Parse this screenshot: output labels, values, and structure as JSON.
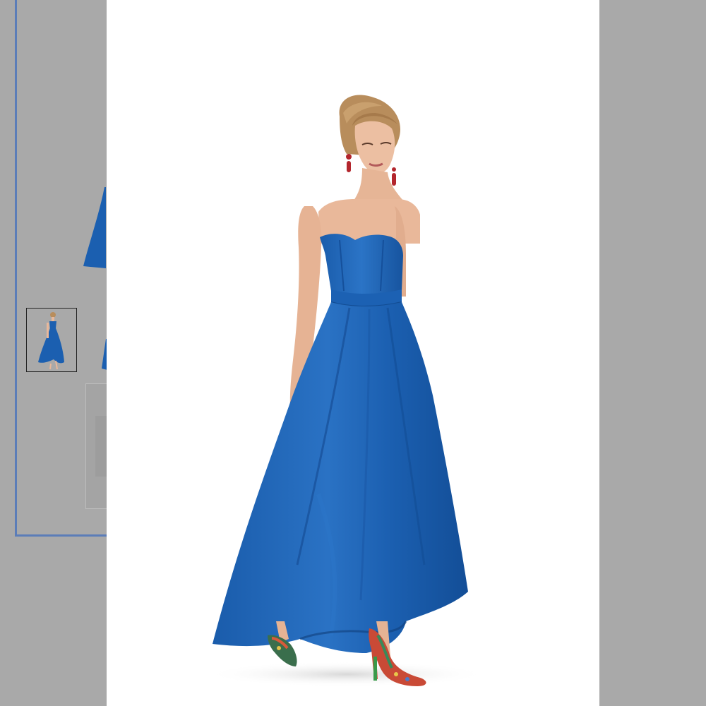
{
  "colors": {
    "overlay": "#a9a9a9",
    "frame_border": "#5b7db8",
    "lightbox_bg": "#ffffff",
    "dress": "#1b5fb0",
    "dress_shadow": "#124c93",
    "dress_highlight": "#2a72c4",
    "skin": "#e9b89a",
    "hair": "#b88d5c"
  },
  "icons": {
    "thumbnail": "dress-thumbnail-icon",
    "product": "blue-strapless-gown-image"
  }
}
